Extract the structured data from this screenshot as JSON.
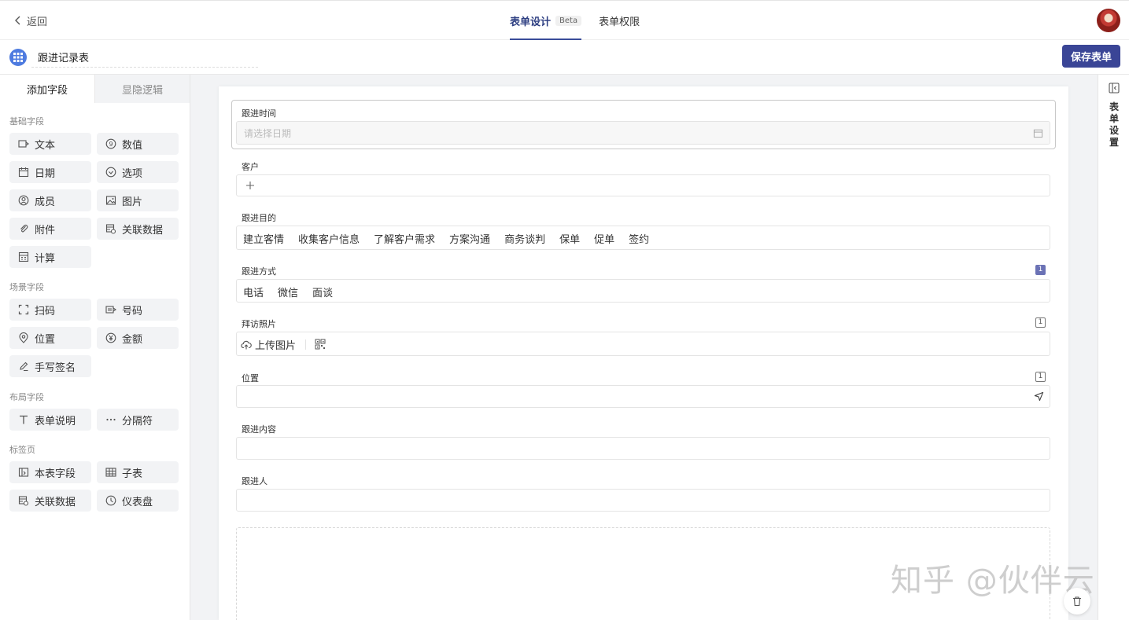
{
  "header": {
    "back_label": "返回",
    "tabs": [
      {
        "label": "表单设计",
        "badge": "Beta",
        "active": true
      },
      {
        "label": "表单权限",
        "active": false
      }
    ]
  },
  "subbar": {
    "form_title": "跟进记录表",
    "save_label": "保存表单"
  },
  "sidebar": {
    "tabs": [
      "添加字段",
      "显隐逻辑"
    ],
    "sections": [
      {
        "title": "基础字段",
        "items": [
          {
            "label": "文本",
            "icon": "text-field-icon"
          },
          {
            "label": "数值",
            "icon": "number-icon"
          },
          {
            "label": "日期",
            "icon": "calendar-icon"
          },
          {
            "label": "选项",
            "icon": "check-circle-icon"
          },
          {
            "label": "成员",
            "icon": "member-icon"
          },
          {
            "label": "图片",
            "icon": "image-icon"
          },
          {
            "label": "附件",
            "icon": "paperclip-icon"
          },
          {
            "label": "关联数据",
            "icon": "link-data-icon"
          },
          {
            "label": "计算",
            "icon": "calculator-icon"
          }
        ]
      },
      {
        "title": "场景字段",
        "items": [
          {
            "label": "扫码",
            "icon": "scan-icon"
          },
          {
            "label": "号码",
            "icon": "serial-number-icon"
          },
          {
            "label": "位置",
            "icon": "location-icon"
          },
          {
            "label": "金额",
            "icon": "currency-icon"
          },
          {
            "label": "手写签名",
            "icon": "signature-icon"
          }
        ]
      },
      {
        "title": "布局字段",
        "items": [
          {
            "label": "表单说明",
            "icon": "text-t-icon"
          },
          {
            "label": "分隔符",
            "icon": "ellipsis-icon"
          }
        ]
      },
      {
        "title": "标签页",
        "items": [
          {
            "label": "本表字段",
            "icon": "table-field-icon"
          },
          {
            "label": "子表",
            "icon": "grid-icon"
          },
          {
            "label": "关联数据",
            "icon": "link-data-icon"
          },
          {
            "label": "仪表盘",
            "icon": "dashboard-icon"
          }
        ]
      }
    ]
  },
  "form": {
    "fields": [
      {
        "label": "跟进时间",
        "placeholder": "请选择日期"
      },
      {
        "label": "客户"
      },
      {
        "label": "跟进目的",
        "options": [
          "建立客情",
          "收集客户信息",
          "了解客户需求",
          "方案沟通",
          "商务谈判",
          "保单",
          "促单",
          "签约"
        ]
      },
      {
        "label": "跟进方式",
        "options": [
          "电话",
          "微信",
          "面谈"
        ],
        "badge": "1"
      },
      {
        "label": "拜访照片",
        "upload_label": "上传图片",
        "badge": "1"
      },
      {
        "label": "位置",
        "badge": "1"
      },
      {
        "label": "跟进内容"
      },
      {
        "label": "跟进人"
      }
    ]
  },
  "right_panel": {
    "label": "表单设置"
  },
  "watermark": "知乎 @伙伴云",
  "colors": {
    "primary": "#3a4596",
    "accent": "#4e7be0"
  }
}
